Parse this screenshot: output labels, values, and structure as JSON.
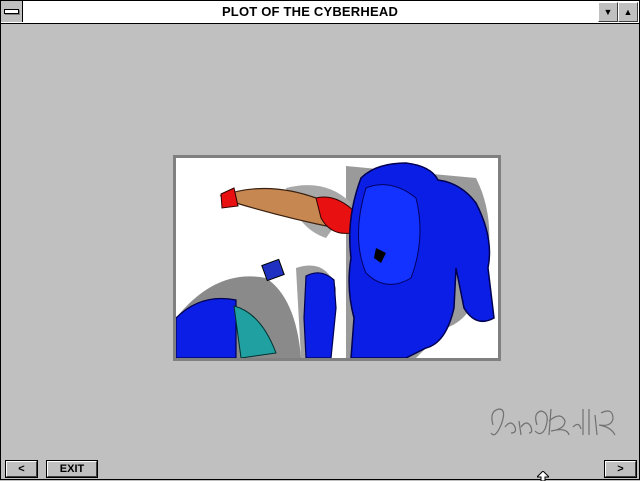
{
  "window": {
    "title": "PLOT OF THE CYBERHEAD"
  },
  "title_buttons": {
    "minimize": "▼",
    "maximize": "▲"
  },
  "illustration": {
    "subject": "cyberhead-plot-illustration"
  },
  "signature": {
    "kind": "handwritten-signature"
  },
  "navigation": {
    "prev_label": "<",
    "exit_label": "EXIT",
    "next_label": ">"
  },
  "colors": {
    "background": "#c0c0c0",
    "frame": "#808080",
    "figure_blue": "#0a1ee6",
    "dress_red": "#e81010",
    "skin": "#c68850",
    "teal": "#20a0a0"
  }
}
